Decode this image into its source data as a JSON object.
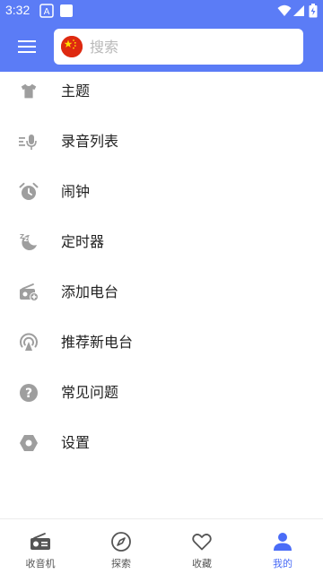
{
  "status_bar": {
    "time": "3:32"
  },
  "search": {
    "placeholder": "搜索",
    "value": ""
  },
  "menu": {
    "items": [
      {
        "label": "主题",
        "icon": "tshirt-icon"
      },
      {
        "label": "录音列表",
        "icon": "recording-list-icon"
      },
      {
        "label": "闹钟",
        "icon": "alarm-clock-icon"
      },
      {
        "label": "定时器",
        "icon": "sleep-timer-icon"
      },
      {
        "label": "添加电台",
        "icon": "add-radio-icon"
      },
      {
        "label": "推荐新电台",
        "icon": "broadcast-icon"
      },
      {
        "label": "常见问题",
        "icon": "help-icon"
      },
      {
        "label": "设置",
        "icon": "settings-icon"
      }
    ]
  },
  "bottom_nav": {
    "items": [
      {
        "label": "收音机",
        "icon": "radio-icon"
      },
      {
        "label": "探索",
        "icon": "compass-icon"
      },
      {
        "label": "收藏",
        "icon": "heart-icon"
      },
      {
        "label": "我的",
        "icon": "person-icon",
        "active": true
      }
    ]
  },
  "colors": {
    "header": "#5b7cf6",
    "icon_gray": "#9e9e9e",
    "active": "#4a6cf7",
    "flag_red": "#de2910",
    "flag_star": "#ffde00"
  }
}
